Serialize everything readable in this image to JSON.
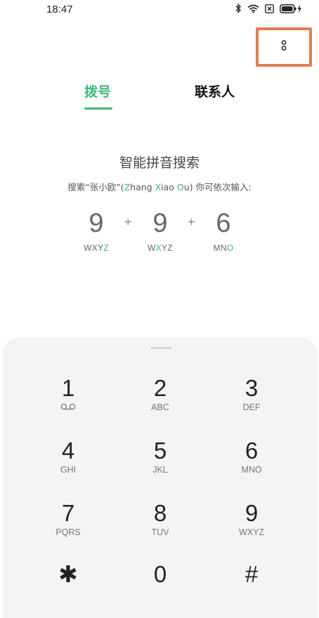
{
  "status_bar": {
    "time": "18:47"
  },
  "tabs": [
    {
      "label": "拨号",
      "active": true
    },
    {
      "label": "联系人",
      "active": false
    }
  ],
  "hint": {
    "title": "智能拼音搜索",
    "line_prefix": "搜索“张小欧”(",
    "line_z": "Z",
    "line_hang": "hang ",
    "line_x": "X",
    "line_iao": "iao ",
    "line_o": "O",
    "line_u": "u",
    "line_suffix": ") 你可依次输入:"
  },
  "example": {
    "items": [
      {
        "digit": "9",
        "letters_plain": "WXY",
        "letters_highlight": "Z",
        "letters_after": ""
      },
      {
        "digit": "9",
        "letters_plain": "W",
        "letters_highlight": "X",
        "letters_after": "YZ"
      },
      {
        "digit": "6",
        "letters_plain": "MN",
        "letters_highlight": "O",
        "letters_after": ""
      }
    ],
    "plus": "+"
  },
  "keypad": {
    "keys": [
      {
        "digit": "1",
        "letters": ""
      },
      {
        "digit": "2",
        "letters": "ABC"
      },
      {
        "digit": "3",
        "letters": "DEF"
      },
      {
        "digit": "4",
        "letters": "GHI"
      },
      {
        "digit": "5",
        "letters": "JKL"
      },
      {
        "digit": "6",
        "letters": "MNO"
      },
      {
        "digit": "7",
        "letters": "PQRS"
      },
      {
        "digit": "8",
        "letters": "TUV"
      },
      {
        "digit": "9",
        "letters": "WXYZ"
      },
      {
        "digit": "✱",
        "letters": ""
      },
      {
        "digit": "0",
        "letters": ""
      },
      {
        "digit": "#",
        "letters": ""
      }
    ]
  },
  "colors": {
    "accent": "#3DB67B",
    "highlight_box": "#E27E4F",
    "keypad_bg": "#F4F4F4"
  },
  "icons": [
    "bluetooth-icon",
    "wifi-icon",
    "sim-off-icon",
    "battery-charging-icon",
    "more-vertical-icon",
    "voicemail-icon"
  ]
}
